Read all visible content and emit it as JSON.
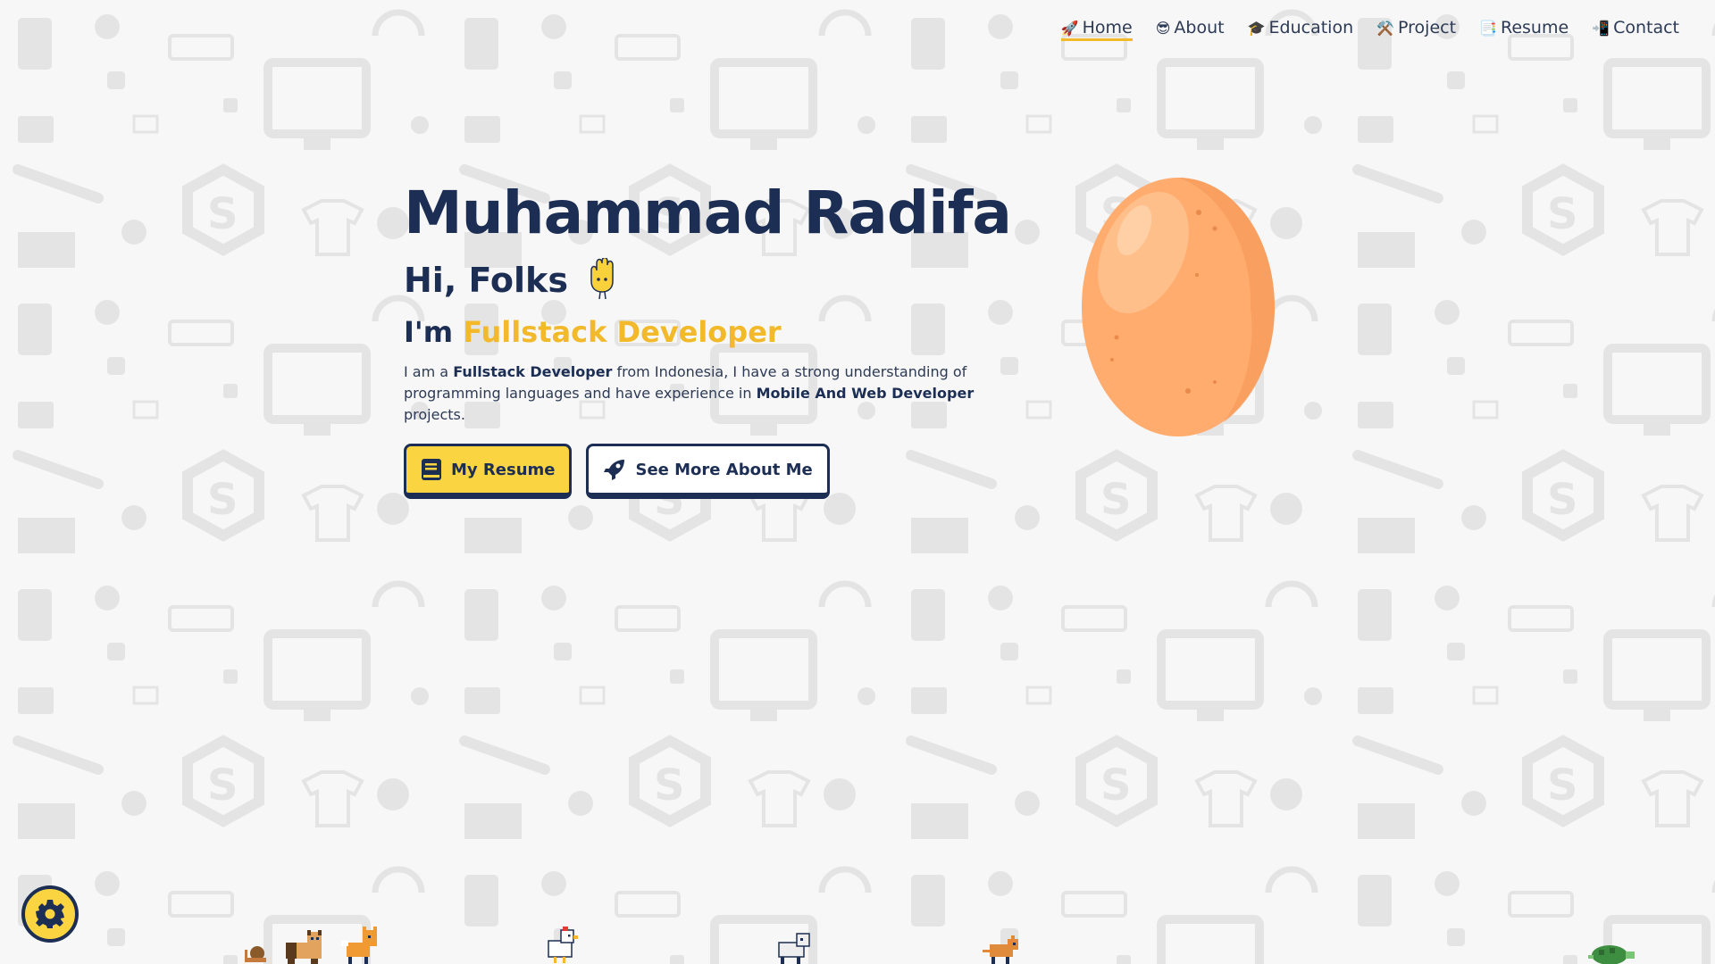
{
  "nav": {
    "items": [
      {
        "emoji": "🚀",
        "label": "Home",
        "active": true
      },
      {
        "emoji": "😎",
        "label": "About",
        "active": false
      },
      {
        "emoji": "🎓",
        "label": "Education",
        "active": false
      },
      {
        "emoji": "⚒️",
        "label": "Project",
        "active": false
      },
      {
        "emoji": "📑",
        "label": "Resume",
        "active": false
      },
      {
        "emoji": "📲",
        "label": "Contact",
        "active": false
      }
    ]
  },
  "hero": {
    "name": "Muhammad Radifa",
    "greeting": "Hi, Folks",
    "role_prefix": "I'm",
    "role": "Fullstack Developer",
    "desc": {
      "p1": "I am a",
      "b1": "Fullstack Developer",
      "p2": "from Indonesia, I have a strong understanding of programming languages and have experience in",
      "b2": "Mobile And Web Developer",
      "p3": "projects."
    }
  },
  "buttons": {
    "resume": "My Resume",
    "about": "See More About Me"
  },
  "colors": {
    "navy": "#1c2e54",
    "accent": "#f2b92b",
    "button_yellow": "#fbd541",
    "egg": "#ffac6e"
  },
  "icons": {
    "greeting": "hand-waving-icon",
    "resume_button": "book-icon",
    "about_button": "rocket-icon",
    "settings": "gear-icon"
  },
  "pets": [
    "snail-pet",
    "cat-pet",
    "fox-pet",
    "chicken-pet",
    "dog-pet",
    "rat-pet",
    "turtle-pet"
  ]
}
